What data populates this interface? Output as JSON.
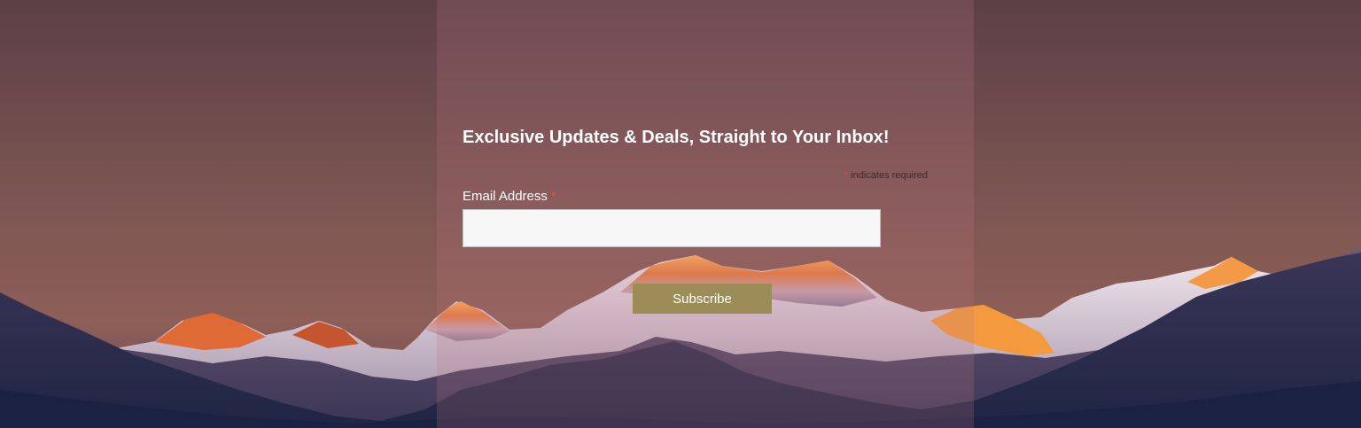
{
  "signup_form": {
    "title": "Exclusive Updates & Deals, Straight to Your Inbox!",
    "required_note": {
      "marker": "*",
      "text": " indicates required"
    },
    "email": {
      "label": "Email Address",
      "required_marker": "*",
      "value": "",
      "placeholder": ""
    },
    "subscribe_label": "Subscribe"
  },
  "colors": {
    "panel_overlay": "#be7882",
    "button": "#9c8c58",
    "required_star": "#d9473f",
    "sky": "#7c5552",
    "mountain_glow": "#f08a3a"
  }
}
